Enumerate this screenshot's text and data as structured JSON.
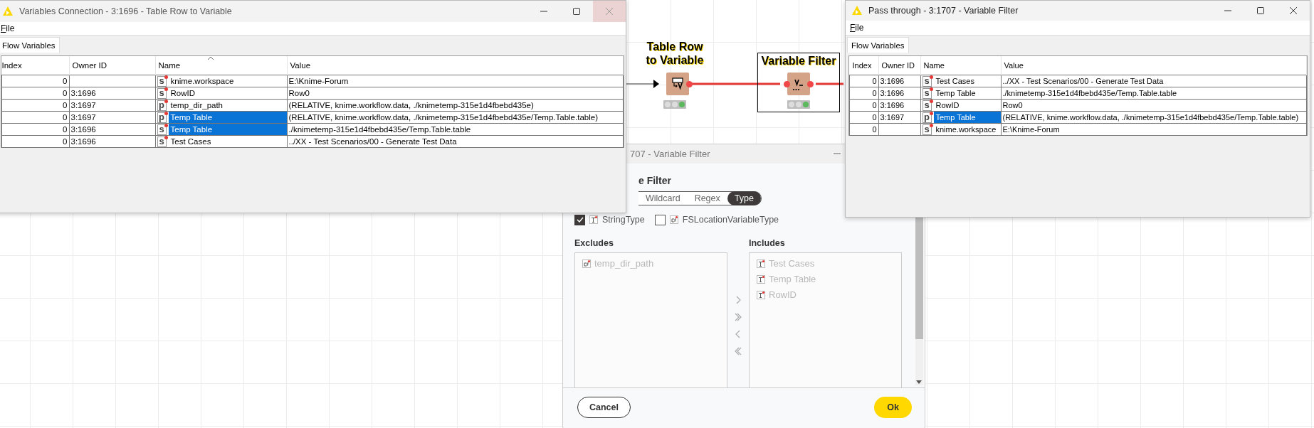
{
  "canvas": {
    "nodes": [
      {
        "kind": "table-row-to-variable",
        "label": "Table Row to Variable",
        "selected": false,
        "executed": true
      },
      {
        "kind": "variable-filter",
        "label": "Variable Filter",
        "selected": true,
        "executed": true
      }
    ]
  },
  "dialog": {
    "title": "707 - Variable Filter",
    "heading": "e Filter",
    "modes": [
      {
        "label": "Wildcard",
        "selected": false
      },
      {
        "label": "Regex",
        "selected": false
      },
      {
        "label": "Type",
        "selected": true
      }
    ],
    "type_filters": [
      {
        "label": "StringType",
        "kind": "string",
        "checked": true
      },
      {
        "label": "FSLocationVariableType",
        "kind": "path",
        "checked": false
      }
    ],
    "excludes": {
      "label": "Excludes",
      "items": [
        {
          "name": "temp_dir_path",
          "kind": "path"
        }
      ]
    },
    "includes": {
      "label": "Includes",
      "items": [
        {
          "name": "Test Cases",
          "kind": "string"
        },
        {
          "name": "Temp Table",
          "kind": "string"
        },
        {
          "name": "RowID",
          "kind": "string"
        }
      ]
    },
    "buttons": [
      {
        "label": "Cancel",
        "kind": "secondary"
      },
      {
        "label": "Ok",
        "kind": "primary"
      }
    ]
  },
  "left_window": {
    "title": "Variables Connection - 3:1696 - Table Row to Variable",
    "close_highlighted": true,
    "menu": [
      "File"
    ],
    "tabs": [
      {
        "label": "Flow Variables",
        "selected": true
      }
    ],
    "columns": [
      {
        "label": "Index",
        "sorted": false
      },
      {
        "label": "Owner ID",
        "sorted": false
      },
      {
        "label": "Name",
        "sorted": true
      },
      {
        "label": "Value",
        "sorted": false
      }
    ],
    "rows": [
      {
        "index": "0",
        "type": "s",
        "name": "knime.workspace",
        "value": "E:\\Knime-Forum",
        "selected": false
      },
      {
        "index": "0",
        "owner_id": "3:1696",
        "type": "s",
        "name": "RowID",
        "value": "Row0",
        "selected": false
      },
      {
        "index": "0",
        "owner_id": "3:1697",
        "type": "p",
        "name": "temp_dir_path",
        "value": "(RELATIVE, knime.workflow.data, ./knimetemp-315e1d4fbebd435e)",
        "selected": false
      },
      {
        "index": "0",
        "owner_id": "3:1697",
        "type": "p",
        "name": "Temp Table",
        "value": "(RELATIVE, knime.workflow.data, ./knimetemp-315e1d4fbebd435e/Temp.Table.table)",
        "selected": true
      },
      {
        "index": "0",
        "owner_id": "3:1696",
        "type": "s",
        "name": "Temp Table",
        "value": "./knimetemp-315e1d4fbebd435e/Temp.Table.table",
        "selected": true
      },
      {
        "index": "0",
        "owner_id": "3:1696",
        "type": "s",
        "name": "Test Cases",
        "value": "../XX - Test Scenarios/00 - Generate Test Data",
        "selected": false
      }
    ]
  },
  "right_window": {
    "title": "Pass through - 3:1707 - Variable Filter",
    "close_highlighted": false,
    "menu": [
      "File"
    ],
    "tabs": [
      {
        "label": "Flow Variables",
        "selected": true
      }
    ],
    "columns": [
      {
        "label": "Index",
        "sorted": false
      },
      {
        "label": "Owner ID",
        "sorted": false
      },
      {
        "label": "Name",
        "sorted": false
      },
      {
        "label": "Value",
        "sorted": false
      }
    ],
    "rows": [
      {
        "index": "0",
        "owner_id": "3:1696",
        "type": "s",
        "name": "Test Cases",
        "value": "../XX - Test Scenarios/00 - Generate Test Data",
        "selected": false
      },
      {
        "index": "0",
        "owner_id": "3:1696",
        "type": "s",
        "name": "Temp Table",
        "value": "./knimetemp-315e1d4fbebd435e/Temp.Table.table",
        "selected": false
      },
      {
        "index": "0",
        "owner_id": "3:1696",
        "type": "s",
        "name": "RowID",
        "value": "Row0",
        "selected": false
      },
      {
        "index": "0",
        "owner_id": "3:1697",
        "type": "p",
        "name": "Temp Table",
        "value": "(RELATIVE, knime.workflow.data, ./knimetemp-315e1d4fbebd435e/Temp.Table.table)",
        "selected": true
      },
      {
        "index": "0",
        "type": "s",
        "name": "knime.workspace",
        "value": "E:\\Knime-Forum",
        "selected": false
      }
    ]
  }
}
